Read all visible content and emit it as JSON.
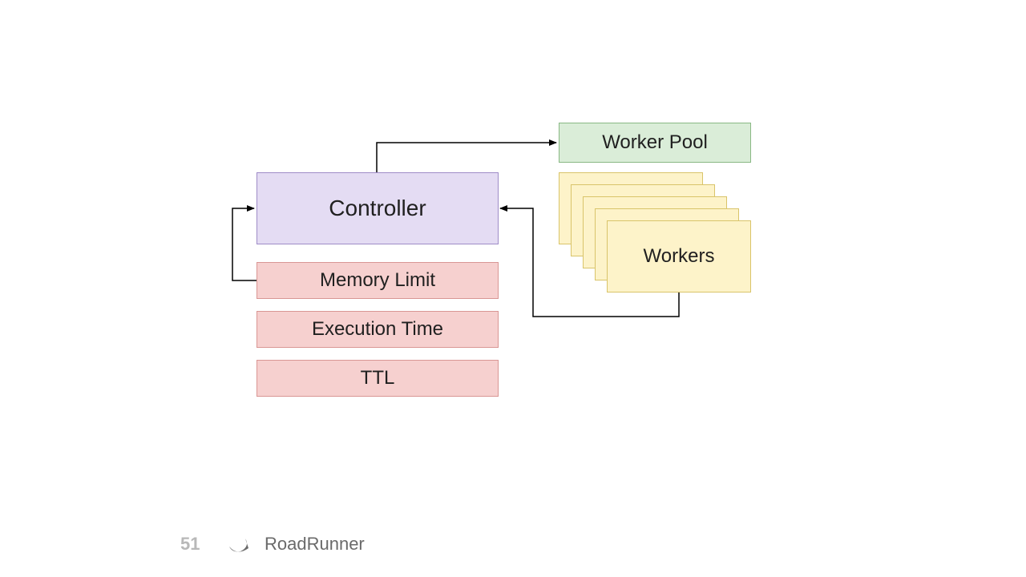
{
  "diagram": {
    "controller": "Controller",
    "memory_limit": "Memory Limit",
    "execution_time": "Execution Time",
    "ttl": "TTL",
    "worker_pool": "Worker Pool",
    "workers": "Workers"
  },
  "footer": {
    "page_number": "51",
    "product_name": "RoadRunner"
  }
}
